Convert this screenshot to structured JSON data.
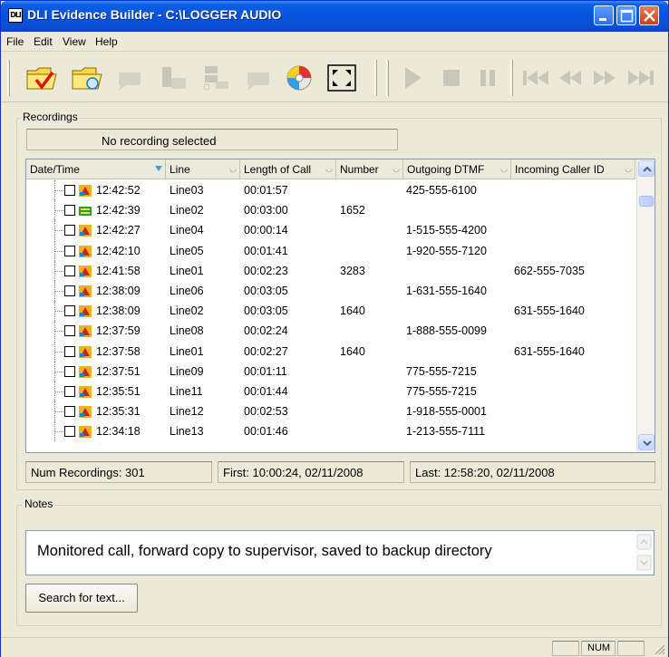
{
  "window": {
    "title": "DLI Evidence Builder - C:\\LOGGER AUDIO",
    "app_icon_text": "DLI",
    "accent_color": "#0553de"
  },
  "menu": [
    {
      "label": "File"
    },
    {
      "label": "Edit"
    },
    {
      "label": "View"
    },
    {
      "label": "Help"
    }
  ],
  "toolbar": {
    "buttons": [
      {
        "icon": "open-checked-folder-icon",
        "enabled": true
      },
      {
        "icon": "open-folder-icon",
        "enabled": true
      },
      {
        "icon": "note-icon",
        "enabled": false
      },
      {
        "icon": "export-icon",
        "enabled": false
      },
      {
        "icon": "network-icon",
        "enabled": false
      },
      {
        "icon": "comment-icon",
        "enabled": false
      },
      {
        "icon": "burn-cd-icon",
        "enabled": true
      },
      {
        "icon": "fullscreen-icon",
        "enabled": true
      }
    ],
    "playback": [
      {
        "icon": "play-icon"
      },
      {
        "icon": "stop-icon"
      },
      {
        "icon": "pause-icon"
      },
      {
        "icon": "skip-back-icon"
      },
      {
        "icon": "rewind-icon"
      },
      {
        "icon": "fast-forward-icon"
      },
      {
        "icon": "skip-forward-icon"
      }
    ]
  },
  "recordings": {
    "group_label": "Recordings",
    "selection_text": "No recording selected",
    "columns": [
      "Date/Time",
      "Line",
      "Length of Call",
      "Number",
      "Outgoing DTMF",
      "Incoming Caller ID"
    ],
    "rows": [
      {
        "time": "12:42:52",
        "line": "Line03",
        "length": "00:01:57",
        "number": "",
        "dtmf": "425-555-6100",
        "callerid": "",
        "icon": "call-icon"
      },
      {
        "time": "12:42:39",
        "line": "Line02",
        "length": "00:03:00",
        "number": "1652",
        "dtmf": "",
        "callerid": "",
        "icon": "extension-call-icon"
      },
      {
        "time": "12:42:27",
        "line": "Line04",
        "length": "00:00:14",
        "number": "",
        "dtmf": "1-515-555-4200",
        "callerid": "",
        "icon": "call-icon"
      },
      {
        "time": "12:42:10",
        "line": "Line05",
        "length": "00:01:41",
        "number": "",
        "dtmf": "1-920-555-7120",
        "callerid": "",
        "icon": "call-icon"
      },
      {
        "time": "12:41:58",
        "line": "Line01",
        "length": "00:02:23",
        "number": "3283",
        "dtmf": "",
        "callerid": "662-555-7035",
        "icon": "call-icon"
      },
      {
        "time": "12:38:09",
        "line": "Line06",
        "length": "00:03:05",
        "number": "",
        "dtmf": "1-631-555-1640",
        "callerid": "",
        "icon": "call-icon"
      },
      {
        "time": "12:38:09",
        "line": "Line02",
        "length": "00:03:05",
        "number": "1640",
        "dtmf": "",
        "callerid": "631-555-1640",
        "icon": "call-icon"
      },
      {
        "time": "12:37:59",
        "line": "Line08",
        "length": "00:02:24",
        "number": "",
        "dtmf": "1-888-555-0099",
        "callerid": "",
        "icon": "call-icon"
      },
      {
        "time": "12:37:58",
        "line": "Line01",
        "length": "00:02:27",
        "number": "1640",
        "dtmf": "",
        "callerid": "631-555-1640",
        "icon": "call-icon"
      },
      {
        "time": "12:37:51",
        "line": "Line09",
        "length": "00:01:11",
        "number": "",
        "dtmf": "775-555-7215",
        "callerid": "",
        "icon": "call-icon"
      },
      {
        "time": "12:35:51",
        "line": "Line11",
        "length": "00:01:44",
        "number": "",
        "dtmf": "775-555-7215",
        "callerid": "",
        "icon": "call-icon"
      },
      {
        "time": "12:35:31",
        "line": "Line12",
        "length": "00:02:53",
        "number": "",
        "dtmf": "1-918-555-0001",
        "callerid": "",
        "icon": "call-icon"
      },
      {
        "time": "12:34:18",
        "line": "Line13",
        "length": "00:01:46",
        "number": "",
        "dtmf": "1-213-555-7111",
        "callerid": "",
        "icon": "call-icon"
      }
    ],
    "num_recordings": "Num Recordings: 301",
    "first": "First: 10:00:24, 02/11/2008",
    "last": "Last: 12:58:20, 02/11/2008"
  },
  "notes": {
    "group_label": "Notes",
    "text": "Monitored call, forward copy to supervisor, saved to backup directory",
    "search_button": "Search for text..."
  },
  "statusbar": {
    "num_indicator": "NUM"
  }
}
